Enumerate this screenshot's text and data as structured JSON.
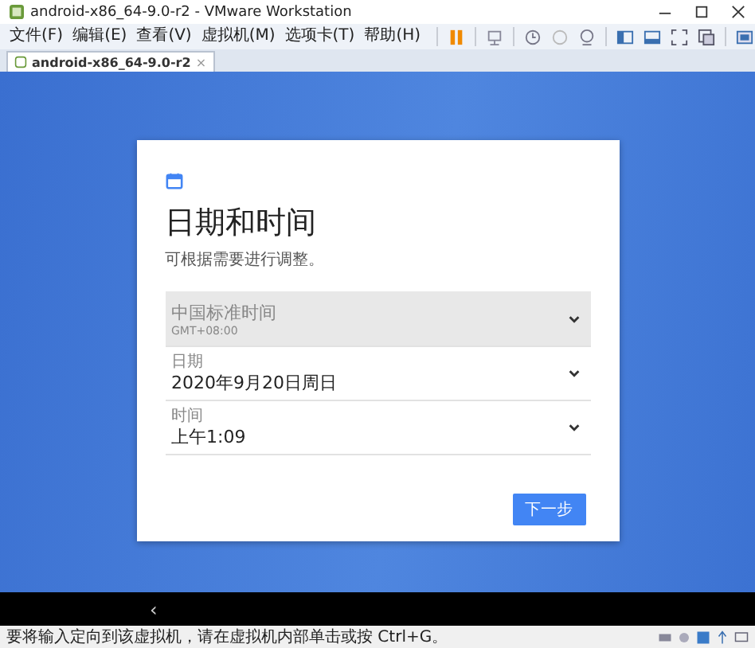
{
  "window": {
    "title": "android-x86_64-9.0-r2 - VMware Workstation"
  },
  "menu": [
    "文件(F)",
    "编辑(E)",
    "查看(V)",
    "虚拟机(M)",
    "选项卡(T)",
    "帮助(H)"
  ],
  "tabs": [
    {
      "label": "android-x86_64-9.0-r2",
      "selected": true,
      "close": "×"
    }
  ],
  "card": {
    "title": "日期和时间",
    "subtitle": "可根据需要进行调整。",
    "rows": [
      {
        "kind": "timezone",
        "value": "中国标准时间",
        "detail": "GMT+08:00",
        "disabled": true
      },
      {
        "kind": "field",
        "label": "日期",
        "value": "2020年9月20日周日",
        "disabled": false
      },
      {
        "kind": "field",
        "label": "时间",
        "value": "上午1:09",
        "disabled": false
      }
    ],
    "next_button": "下一步"
  },
  "nav": {
    "back": "‹"
  },
  "status_bar": "要将输入定向到该虚拟机，请在虚拟机内部单击或按 Ctrl+G。"
}
